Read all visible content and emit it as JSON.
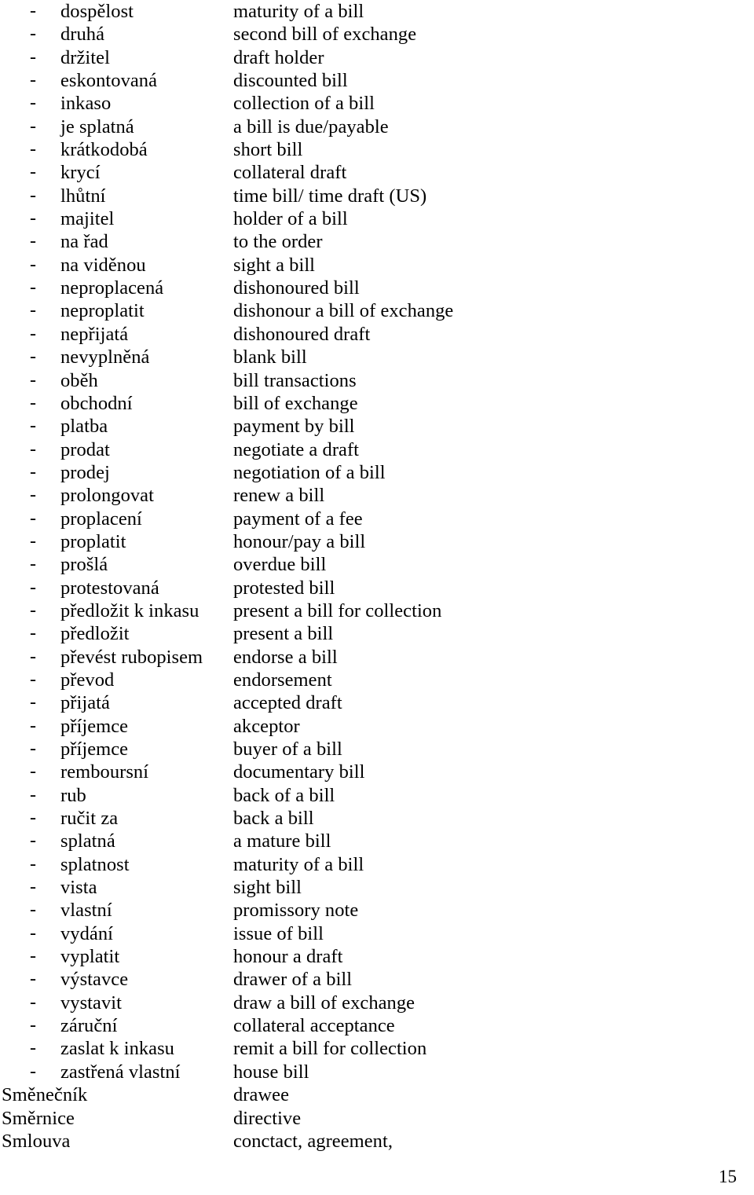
{
  "document": {
    "page_number": "15",
    "bullet_glyph": "-"
  },
  "glossary": {
    "entries": [
      {
        "bullet": "-",
        "term": "dospělost",
        "gloss": "maturity of a bill"
      },
      {
        "bullet": "-",
        "term": "druhá",
        "gloss": "second bill of exchange"
      },
      {
        "bullet": "-",
        "term": "držitel",
        "gloss": "draft holder"
      },
      {
        "bullet": "-",
        "term": "eskontovaná",
        "gloss": "discounted bill"
      },
      {
        "bullet": "-",
        "term": "inkaso",
        "gloss": "collection of a bill"
      },
      {
        "bullet": "-",
        "term": "je splatná",
        "gloss": "a bill is due/payable"
      },
      {
        "bullet": "-",
        "term": "krátkodobá",
        "gloss": "short bill"
      },
      {
        "bullet": "-",
        "term": "krycí",
        "gloss": "collateral draft"
      },
      {
        "bullet": "-",
        "term": "lhůtní",
        "gloss": "time bill/ time draft (US)"
      },
      {
        "bullet": "-",
        "term": "majitel",
        "gloss": "holder of a bill"
      },
      {
        "bullet": "-",
        "term": "na řad",
        "gloss": "to the order"
      },
      {
        "bullet": "-",
        "term": "na viděnou",
        "gloss": "sight a bill"
      },
      {
        "bullet": "-",
        "term": "neproplacená",
        "gloss": "dishonoured bill"
      },
      {
        "bullet": "-",
        "term": "neproplatit",
        "gloss": "dishonour a bill of exchange"
      },
      {
        "bullet": "-",
        "term": "nepřijatá",
        "gloss": "dishonoured draft"
      },
      {
        "bullet": "-",
        "term": "nevyplněná",
        "gloss": "blank bill"
      },
      {
        "bullet": "-",
        "term": "oběh",
        "gloss": "bill transactions"
      },
      {
        "bullet": "-",
        "term": "obchodní",
        "gloss": "bill of exchange"
      },
      {
        "bullet": "-",
        "term": "platba",
        "gloss": "payment by bill"
      },
      {
        "bullet": "-",
        "term": "prodat",
        "gloss": "negotiate a draft"
      },
      {
        "bullet": "-",
        "term": "prodej",
        "gloss": "negotiation of a bill"
      },
      {
        "bullet": "-",
        "term": "prolongovat",
        "gloss": "renew a bill"
      },
      {
        "bullet": "-",
        "term": "proplacení",
        "gloss": "payment of a fee"
      },
      {
        "bullet": "-",
        "term": "proplatit",
        "gloss": "honour/pay a bill"
      },
      {
        "bullet": "-",
        "term": "prošlá",
        "gloss": "overdue bill"
      },
      {
        "bullet": "-",
        "term": "protestovaná",
        "gloss": "protested bill"
      },
      {
        "bullet": "-",
        "term": "předložit k inkasu",
        "gloss": "present a bill for collection"
      },
      {
        "bullet": "-",
        "term": "předložit",
        "gloss": "present a bill"
      },
      {
        "bullet": "-",
        "term": "převést rubopisem",
        "gloss": "endorse a bill"
      },
      {
        "bullet": "-",
        "term": "převod",
        "gloss": "endorsement"
      },
      {
        "bullet": "-",
        "term": "přijatá",
        "gloss": "accepted draft"
      },
      {
        "bullet": "-",
        "term": "příjemce",
        "gloss": "akceptor"
      },
      {
        "bullet": "-",
        "term": "příjemce",
        "gloss": "buyer of a bill"
      },
      {
        "bullet": "-",
        "term": "remboursní",
        "gloss": "documentary bill"
      },
      {
        "bullet": "-",
        "term": "rub",
        "gloss": "back of a bill"
      },
      {
        "bullet": "-",
        "term": "ručit za",
        "gloss": "back a bill"
      },
      {
        "bullet": "-",
        "term": "splatná",
        "gloss": "a mature bill"
      },
      {
        "bullet": "-",
        "term": "splatnost",
        "gloss": "maturity of a bill"
      },
      {
        "bullet": "-",
        "term": "vista",
        "gloss": "sight bill"
      },
      {
        "bullet": "-",
        "term": "vlastní",
        "gloss": "promissory note"
      },
      {
        "bullet": "-",
        "term": "vydání",
        "gloss": "issue of bill"
      },
      {
        "bullet": "-",
        "term": "vyplatit",
        "gloss": "honour a draft"
      },
      {
        "bullet": "-",
        "term": "výstavce",
        "gloss": "drawer of a bill"
      },
      {
        "bullet": "-",
        "term": "vystavit",
        "gloss": "draw a bill of exchange"
      },
      {
        "bullet": "-",
        "term": "záruční",
        "gloss": "collateral acceptance"
      },
      {
        "bullet": "-",
        "term": "zaslat k inkasu",
        "gloss": "remit a bill for collection"
      },
      {
        "bullet": "-",
        "term": "zastřená vlastní",
        "gloss": "house bill"
      },
      {
        "bullet": "",
        "term": "Směnečník",
        "gloss": "drawee"
      },
      {
        "bullet": "",
        "term": "Směrnice",
        "gloss": "directive"
      },
      {
        "bullet": "",
        "term": "Smlouva",
        "gloss": "conctact, agreement,"
      }
    ]
  }
}
